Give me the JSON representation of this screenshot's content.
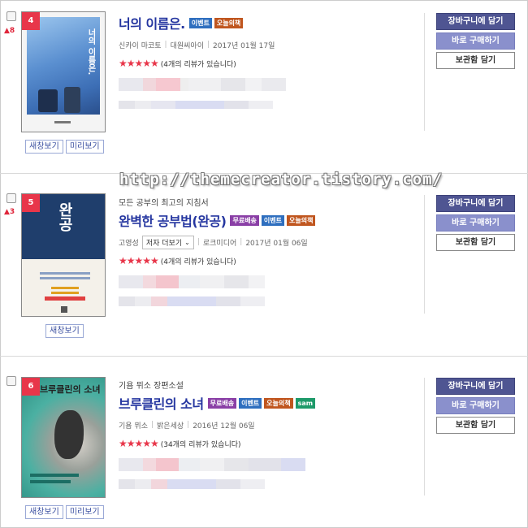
{
  "watermark": "http://themecreator.tistory.com/",
  "buttons": {
    "cart": "장바구니에 담기",
    "buy": "바로 구매하기",
    "save": "보관함 담기"
  },
  "preview": {
    "new_window": "새창보기",
    "look_inside": "미리보기"
  },
  "tag_colors": {
    "이벤트": "#2f6fbf",
    "오늘의책": "#c0561f",
    "무료배송": "#8a3fa6",
    "sam": "#1e9a6a"
  },
  "books": [
    {
      "rank": "4",
      "rank_change": "▲8",
      "subtitle": "",
      "title": "너의 이름은.",
      "tags": [
        "이벤트",
        "오늘의책"
      ],
      "author": "신카이 마코토",
      "author_more": "",
      "publisher": "대원씨아이",
      "date": "2017년 01월 17일",
      "rating_stars": "★★★★★",
      "rating": 5,
      "reviews": "(4개의 리뷰가 있습니다)",
      "cover_text": "너의 이름은.",
      "cover_color": "#6a9fd2"
    },
    {
      "rank": "5",
      "rank_change": "▲3",
      "subtitle": "모든 공부의 최고의 지침서",
      "title": "완벽한 공부법(완공)",
      "tags": [
        "무료배송",
        "이벤트",
        "오늘의책"
      ],
      "author": "고영성",
      "author_more": "저자 더보기",
      "publisher": "로크미디어",
      "date": "2017년 01월 06일",
      "rating_stars": "★★★★★",
      "rating": 5,
      "reviews": "(4개의 리뷰가 있습니다)",
      "cover_text": "완공",
      "cover_color": "#213f6e"
    },
    {
      "rank": "6",
      "rank_change": "",
      "subtitle": "기욤 뮈소 장편소설",
      "title": "브루클린의 소녀",
      "tags": [
        "무료배송",
        "이벤트",
        "오늘의책",
        "sam"
      ],
      "author": "기욤 뮈소",
      "author_more": "",
      "publisher": "밝은세상",
      "date": "2016년 12월 06일",
      "rating_stars": "★★★★★",
      "rating": 5,
      "reviews": "(34개의 리뷰가 있습니다)",
      "cover_text": "브루클린의 소녀",
      "cover_color": "#4bb0a2"
    }
  ]
}
